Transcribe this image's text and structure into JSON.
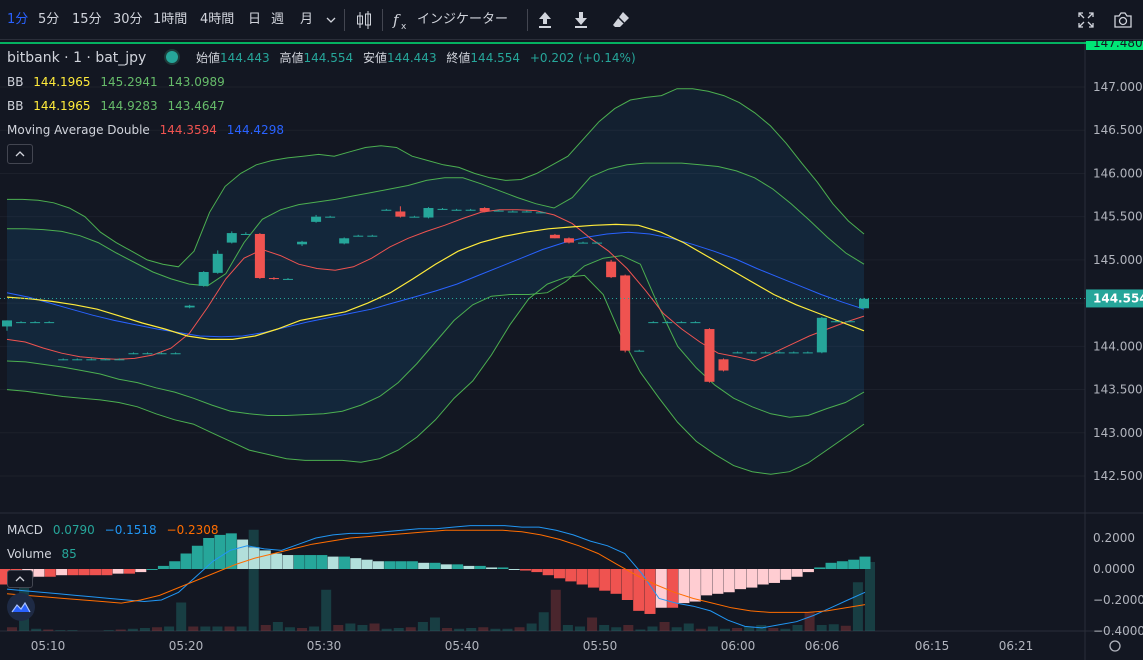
{
  "toolbar": {
    "timeframes": [
      {
        "label": "1分",
        "active": true
      },
      {
        "label": "5分",
        "active": false
      },
      {
        "label": "15分",
        "active": false
      },
      {
        "label": "30分",
        "active": false
      },
      {
        "label": "1時間",
        "active": false
      },
      {
        "label": "4時間",
        "active": false
      },
      {
        "label": "日",
        "active": false
      },
      {
        "label": "週",
        "active": false
      },
      {
        "label": "月",
        "active": false
      }
    ],
    "indicators_label": "インジケーター",
    "icons": [
      "chevron-down-icon",
      "candles-icon",
      "fx-icon",
      "upload-icon",
      "download-icon",
      "eraser-icon",
      "fullscreen-icon",
      "camera-icon"
    ]
  },
  "legend": {
    "symbol": "bitbank · 1 · bat_jpy",
    "open_label": "始値",
    "open": "144.443",
    "high_label": "高値",
    "high": "144.554",
    "low_label": "安値",
    "low": "144.443",
    "close_label": "終値",
    "close": "144.554",
    "change": "+0.202 (+0.14%)",
    "bb1": {
      "name": "BB",
      "basis": "144.1965",
      "upper": "145.2941",
      "lower": "143.0989"
    },
    "bb2": {
      "name": "BB",
      "basis": "144.1965",
      "upper": "144.9283",
      "lower": "143.4647"
    },
    "ma": {
      "name": "Moving Average Double",
      "v1": "144.3594",
      "v2": "144.4298"
    },
    "macd": {
      "name": "MACD",
      "hist": "0.0790",
      "macd": "−0.1518",
      "signal": "−0.2308"
    },
    "volume": {
      "name": "Volume",
      "value": "85"
    }
  },
  "price_axis": {
    "labels": [
      "147.000",
      "146.500",
      "146.000",
      "145.500",
      "145.000",
      "144.500",
      "144.000",
      "143.500",
      "143.000",
      "142.500"
    ],
    "top_label": "147.480",
    "current_label": "144.554"
  },
  "macd_axis": {
    "labels": [
      "0.2000",
      "0.0000",
      "−0.2000",
      "−0.4000"
    ]
  },
  "time_axis": {
    "labels": [
      "05:10",
      "05:20",
      "05:30",
      "05:40",
      "05:50",
      "06:00",
      "06:06",
      "06:15",
      "06:21"
    ]
  },
  "colors": {
    "up": "#26a69a",
    "down": "#ef5350",
    "bb_band": "#4caf50",
    "ma1": "#ef5350",
    "ma2": "#2962ff",
    "basis": "#ffeb3b",
    "macd": "#2196f3",
    "signal": "#ff6d00",
    "top_line": "#00e676"
  },
  "chart_data": {
    "type": "candlestick",
    "price_range": [
      142.3,
      147.6
    ],
    "candles": [
      {
        "o": 144.23,
        "h": 144.3,
        "l": 144.18,
        "c": 144.3
      },
      {
        "o": 144.28,
        "h": 144.29,
        "l": 144.27,
        "c": 144.28
      },
      {
        "o": 144.28,
        "h": 144.29,
        "l": 144.27,
        "c": 144.28
      },
      {
        "o": 144.28,
        "h": 144.29,
        "l": 144.27,
        "c": 144.28
      },
      {
        "o": 143.85,
        "h": 143.86,
        "l": 143.84,
        "c": 143.85
      },
      {
        "o": 143.85,
        "h": 143.86,
        "l": 143.84,
        "c": 143.85
      },
      {
        "o": 143.85,
        "h": 143.86,
        "l": 143.84,
        "c": 143.85
      },
      {
        "o": 143.85,
        "h": 143.86,
        "l": 143.84,
        "c": 143.85
      },
      {
        "o": 143.85,
        "h": 143.86,
        "l": 143.84,
        "c": 143.85
      },
      {
        "o": 143.92,
        "h": 143.93,
        "l": 143.91,
        "c": 143.92
      },
      {
        "o": 143.92,
        "h": 143.93,
        "l": 143.91,
        "c": 143.92
      },
      {
        "o": 143.92,
        "h": 143.93,
        "l": 143.91,
        "c": 143.92
      },
      {
        "o": 143.92,
        "h": 143.93,
        "l": 143.91,
        "c": 143.92
      },
      {
        "o": 144.45,
        "h": 144.48,
        "l": 144.44,
        "c": 144.47
      },
      {
        "o": 144.7,
        "h": 144.87,
        "l": 144.69,
        "c": 144.86
      },
      {
        "o": 144.85,
        "h": 145.11,
        "l": 144.84,
        "c": 145.07
      },
      {
        "o": 145.2,
        "h": 145.33,
        "l": 145.19,
        "c": 145.31
      },
      {
        "o": 145.3,
        "h": 145.32,
        "l": 145.29,
        "c": 145.3
      },
      {
        "o": 145.3,
        "h": 145.31,
        "l": 144.78,
        "c": 144.79
      },
      {
        "o": 144.79,
        "h": 144.8,
        "l": 144.77,
        "c": 144.78
      },
      {
        "o": 144.78,
        "h": 144.79,
        "l": 144.77,
        "c": 144.78
      },
      {
        "o": 145.18,
        "h": 145.22,
        "l": 145.16,
        "c": 145.21
      },
      {
        "o": 145.44,
        "h": 145.52,
        "l": 145.43,
        "c": 145.5
      },
      {
        "o": 145.5,
        "h": 145.51,
        "l": 145.49,
        "c": 145.5
      },
      {
        "o": 145.19,
        "h": 145.26,
        "l": 145.18,
        "c": 145.25
      },
      {
        "o": 145.28,
        "h": 145.29,
        "l": 145.27,
        "c": 145.28
      },
      {
        "o": 145.28,
        "h": 145.29,
        "l": 145.27,
        "c": 145.28
      },
      {
        "o": 145.58,
        "h": 145.59,
        "l": 145.57,
        "c": 145.58
      },
      {
        "o": 145.56,
        "h": 145.62,
        "l": 145.49,
        "c": 145.5
      },
      {
        "o": 145.5,
        "h": 145.51,
        "l": 145.49,
        "c": 145.5
      },
      {
        "o": 145.49,
        "h": 145.61,
        "l": 145.48,
        "c": 145.6
      },
      {
        "o": 145.59,
        "h": 145.6,
        "l": 145.58,
        "c": 145.59
      },
      {
        "o": 145.58,
        "h": 145.59,
        "l": 145.57,
        "c": 145.58
      },
      {
        "o": 145.58,
        "h": 145.59,
        "l": 145.57,
        "c": 145.58
      },
      {
        "o": 145.6,
        "h": 145.61,
        "l": 145.55,
        "c": 145.56
      },
      {
        "o": 145.57,
        "h": 145.58,
        "l": 145.56,
        "c": 145.57
      },
      {
        "o": 145.56,
        "h": 145.57,
        "l": 145.55,
        "c": 145.56
      },
      {
        "o": 145.56,
        "h": 145.57,
        "l": 145.55,
        "c": 145.56
      },
      {
        "o": 145.55,
        "h": 145.56,
        "l": 145.54,
        "c": 145.55
      },
      {
        "o": 145.29,
        "h": 145.3,
        "l": 145.25,
        "c": 145.25
      },
      {
        "o": 145.25,
        "h": 145.26,
        "l": 145.19,
        "c": 145.2
      },
      {
        "o": 145.2,
        "h": 145.21,
        "l": 145.19,
        "c": 145.2
      },
      {
        "o": 145.2,
        "h": 145.21,
        "l": 145.19,
        "c": 145.2
      },
      {
        "o": 144.98,
        "h": 145.0,
        "l": 144.79,
        "c": 144.8
      },
      {
        "o": 144.82,
        "h": 144.83,
        "l": 143.93,
        "c": 143.95
      },
      {
        "o": 143.95,
        "h": 143.96,
        "l": 143.94,
        "c": 143.95
      },
      {
        "o": 144.28,
        "h": 144.29,
        "l": 144.27,
        "c": 144.28
      },
      {
        "o": 144.28,
        "h": 144.29,
        "l": 144.27,
        "c": 144.28
      },
      {
        "o": 144.28,
        "h": 144.29,
        "l": 144.27,
        "c": 144.28
      },
      {
        "o": 144.28,
        "h": 144.29,
        "l": 144.27,
        "c": 144.28
      },
      {
        "o": 144.2,
        "h": 144.21,
        "l": 143.58,
        "c": 143.59
      },
      {
        "o": 143.85,
        "h": 143.86,
        "l": 143.71,
        "c": 143.72
      },
      {
        "o": 143.93,
        "h": 143.94,
        "l": 143.92,
        "c": 143.93
      },
      {
        "o": 143.93,
        "h": 143.94,
        "l": 143.92,
        "c": 143.93
      },
      {
        "o": 143.93,
        "h": 143.94,
        "l": 143.92,
        "c": 143.93
      },
      {
        "o": 143.93,
        "h": 143.94,
        "l": 143.92,
        "c": 143.93
      },
      {
        "o": 143.93,
        "h": 143.94,
        "l": 143.92,
        "c": 143.93
      },
      {
        "o": 143.93,
        "h": 143.94,
        "l": 143.92,
        "c": 143.93
      },
      {
        "o": 143.93,
        "h": 144.34,
        "l": 143.92,
        "c": 144.33
      },
      {
        "o": 144.29,
        "h": 144.3,
        "l": 144.28,
        "c": 144.29
      },
      {
        "o": 144.29,
        "h": 144.3,
        "l": 144.28,
        "c": 144.29
      },
      {
        "o": 144.44,
        "h": 144.56,
        "l": 144.44,
        "c": 144.55
      }
    ],
    "bb1_upper": [
      145.7,
      145.7,
      145.69,
      145.66,
      145.6,
      145.5,
      145.32,
      145.2,
      145.1,
      145.0,
      144.95,
      144.92,
      145.1,
      145.55,
      145.85,
      146.0,
      146.1,
      146.15,
      146.18,
      146.2,
      146.22,
      146.2,
      146.25,
      146.3,
      146.32,
      146.3,
      146.2,
      146.15,
      146.1,
      146.07,
      146.0,
      145.95,
      145.92,
      145.93,
      146.0,
      146.1,
      146.2,
      146.4,
      146.6,
      146.75,
      146.85,
      146.88,
      146.9,
      146.98,
      146.98,
      146.95,
      146.9,
      146.82,
      146.7,
      146.55,
      146.35,
      146.12,
      145.9,
      145.65,
      145.45,
      145.3
    ],
    "bb2_upper": [
      145.36,
      145.36,
      145.35,
      145.33,
      145.28,
      145.2,
      145.08,
      144.97,
      144.86,
      144.78,
      144.72,
      144.7,
      144.84,
      145.2,
      145.47,
      145.58,
      145.64,
      145.67,
      145.7,
      145.74,
      145.78,
      145.82,
      145.86,
      145.92,
      145.95,
      145.95,
      145.88,
      145.8,
      145.72,
      145.65,
      145.6,
      145.72,
      145.96,
      146.05,
      146.1,
      146.12,
      146.12,
      146.12,
      146.1,
      146.08,
      146.03,
      145.95,
      145.82,
      145.65,
      145.46,
      145.26,
      145.08,
      144.95
    ],
    "bb1_lower": [
      143.5,
      143.48,
      143.45,
      143.42,
      143.4,
      143.38,
      143.35,
      143.3,
      143.22,
      143.15,
      143.1,
      143.0,
      142.9,
      142.8,
      142.75,
      142.7,
      142.68,
      142.68,
      142.68,
      142.66,
      142.7,
      142.8,
      142.95,
      143.15,
      143.4,
      143.6,
      143.9,
      144.25,
      144.55,
      144.72,
      144.8,
      144.82,
      144.6,
      144.1,
      143.7,
      143.4,
      143.12,
      142.9,
      142.75,
      142.62,
      142.55,
      142.52,
      142.55,
      142.65,
      142.8,
      142.95,
      143.1
    ],
    "bb2_lower": [
      143.83,
      143.82,
      143.79,
      143.76,
      143.72,
      143.68,
      143.62,
      143.58,
      143.52,
      143.47,
      143.4,
      143.32,
      143.25,
      143.22,
      143.2,
      143.2,
      143.21,
      143.22,
      143.25,
      143.32,
      143.42,
      143.58,
      143.8,
      144.05,
      144.3,
      144.48,
      144.58,
      144.6,
      144.6,
      144.62,
      144.75,
      144.93,
      145.02,
      145.05,
      144.95,
      144.45,
      144.0,
      143.75,
      143.55,
      143.4,
      143.3,
      143.22,
      143.18,
      143.2,
      143.28,
      143.35,
      143.47
    ],
    "ma1": [
      144.08,
      144.05,
      143.98,
      143.92,
      143.88,
      143.86,
      143.85,
      143.86,
      143.9,
      143.98,
      144.15,
      144.45,
      144.78,
      145.02,
      145.12,
      145.05,
      144.95,
      144.9,
      144.88,
      144.92,
      145.02,
      145.15,
      145.25,
      145.33,
      145.4,
      145.48,
      145.55,
      145.58,
      145.58,
      145.57,
      145.52,
      145.42,
      145.25,
      145.1,
      144.9,
      144.65,
      144.38,
      144.2,
      144.05,
      143.92,
      143.88,
      143.83,
      143.92,
      144.02,
      144.12,
      144.2,
      144.28,
      144.35
    ],
    "ma2": [
      144.62,
      144.57,
      144.5,
      144.43,
      144.36,
      144.3,
      144.25,
      144.2,
      144.16,
      144.12,
      144.11,
      144.12,
      144.16,
      144.22,
      144.28,
      144.33,
      144.38,
      144.43,
      144.5,
      144.57,
      144.64,
      144.72,
      144.82,
      144.92,
      145.02,
      145.12,
      145.2,
      145.26,
      145.3,
      145.32,
      145.3,
      145.25,
      145.18,
      145.1,
      145.01,
      144.9,
      144.8,
      144.7,
      144.6,
      144.51,
      144.43
    ],
    "basis": [
      144.57,
      144.55,
      144.52,
      144.48,
      144.43,
      144.35,
      144.27,
      144.2,
      144.12,
      144.08,
      144.08,
      144.12,
      144.2,
      144.3,
      144.35,
      144.4,
      144.5,
      144.62,
      144.78,
      144.95,
      145.1,
      145.2,
      145.27,
      145.32,
      145.36,
      145.38,
      145.4,
      145.41,
      145.4,
      145.32,
      145.2,
      145.05,
      144.9,
      144.75,
      144.6,
      144.48,
      144.38,
      144.28,
      144.18
    ],
    "macd_hist": [
      -0.1,
      -0.1,
      -0.06,
      -0.05,
      -0.05,
      -0.04,
      -0.04,
      -0.04,
      -0.04,
      -0.04,
      -0.03,
      -0.03,
      -0.02,
      0.0,
      0.02,
      0.05,
      0.1,
      0.15,
      0.2,
      0.22,
      0.23,
      0.19,
      0.14,
      0.12,
      0.1,
      0.09,
      0.09,
      0.09,
      0.09,
      0.08,
      0.08,
      0.07,
      0.06,
      0.05,
      0.05,
      0.05,
      0.05,
      0.04,
      0.04,
      0.03,
      0.03,
      0.02,
      0.02,
      0.01,
      0.01,
      0.0,
      -0.01,
      -0.02,
      -0.04,
      -0.06,
      -0.08,
      -0.1,
      -0.12,
      -0.14,
      -0.16,
      -0.2,
      -0.27,
      -0.29,
      -0.25,
      -0.25,
      -0.22,
      -0.21,
      -0.17,
      -0.16,
      -0.15,
      -0.13,
      -0.12,
      -0.1,
      -0.09,
      -0.07,
      -0.05,
      -0.02,
      0.01,
      0.04,
      0.05,
      0.06,
      0.08
    ],
    "macd_line": [
      -0.13,
      -0.14,
      -0.15,
      -0.16,
      -0.17,
      -0.18,
      -0.19,
      -0.2,
      -0.21,
      -0.2,
      -0.15,
      -0.05,
      0.05,
      0.12,
      0.15,
      0.13,
      0.12,
      0.16,
      0.2,
      0.22,
      0.23,
      0.23,
      0.24,
      0.25,
      0.26,
      0.26,
      0.27,
      0.28,
      0.28,
      0.28,
      0.27,
      0.27,
      0.25,
      0.22,
      0.18,
      0.15,
      0.1,
      -0.03,
      -0.19,
      -0.22,
      -0.24,
      -0.27,
      -0.33,
      -0.37,
      -0.38,
      -0.36,
      -0.34,
      -0.3,
      -0.25,
      -0.2,
      -0.15
    ],
    "signal_line": [
      -0.16,
      -0.17,
      -0.18,
      -0.19,
      -0.2,
      -0.21,
      -0.22,
      -0.2,
      -0.17,
      -0.12,
      -0.07,
      -0.02,
      0.03,
      0.07,
      0.1,
      0.13,
      0.16,
      0.18,
      0.2,
      0.21,
      0.22,
      0.23,
      0.24,
      0.25,
      0.25,
      0.25,
      0.25,
      0.24,
      0.22,
      0.19,
      0.15,
      0.1,
      0.03,
      -0.04,
      -0.1,
      -0.15,
      -0.19,
      -0.22,
      -0.25,
      -0.27,
      -0.28,
      -0.28,
      -0.28,
      -0.27,
      -0.25,
      -0.23
    ],
    "volume": [
      5,
      68,
      3,
      2,
      1,
      1,
      0,
      0,
      1,
      2,
      3,
      4,
      5,
      6,
      38,
      6,
      6,
      6,
      6,
      6,
      135,
      8,
      12,
      5,
      4,
      6,
      55,
      8,
      10,
      8,
      10,
      3,
      4,
      5,
      12,
      18,
      4,
      3,
      4,
      5,
      3,
      3,
      5,
      10,
      25,
      55,
      8,
      6,
      18,
      8,
      5,
      8,
      2,
      6,
      12,
      5,
      10,
      3,
      6,
      3,
      4,
      6,
      8,
      4,
      3,
      8,
      25,
      8,
      9,
      7,
      65,
      92
    ]
  }
}
